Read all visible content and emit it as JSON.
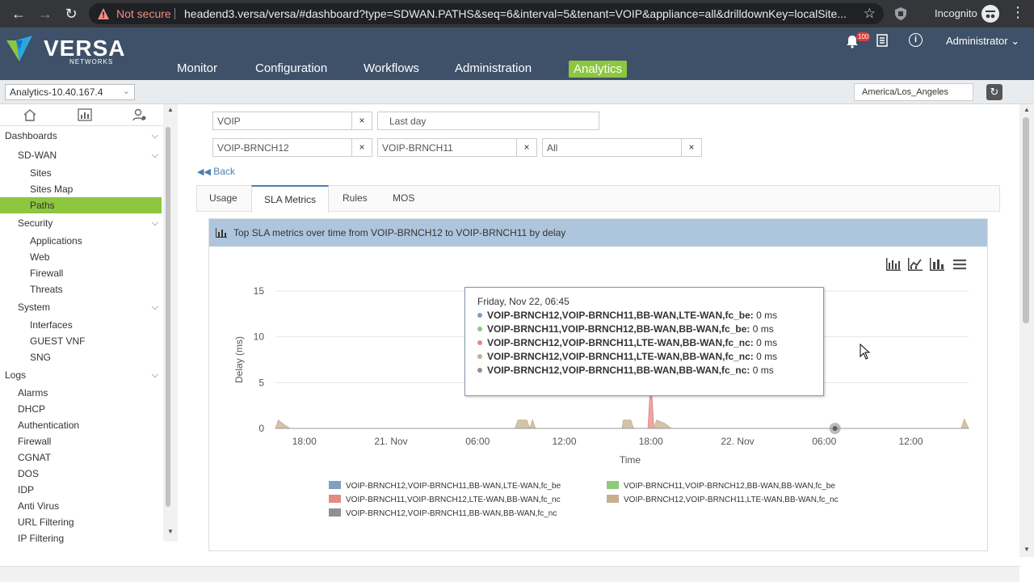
{
  "browser": {
    "not_secure": "Not secure",
    "url": "headend3.versa/versa/#dashboard?type=SDWAN.PATHS&seq=6&interval=5&tenant=VOIP&appliance=all&drilldownKey=localSite...",
    "incognito": "Incognito"
  },
  "brand": {
    "name": "VERSA",
    "sub": "NETWORKS"
  },
  "nav": [
    "Monitor",
    "Configuration",
    "Workflows",
    "Administration",
    "Analytics"
  ],
  "header": {
    "badge": "100",
    "user": "Administrator"
  },
  "subbar": {
    "appliance": "Analytics-10.40.167.4",
    "timezone": "America/Los_Angeles"
  },
  "sidebar": {
    "items": [
      {
        "label": "Dashboards",
        "level": "lvl0",
        "chevron": true
      },
      {
        "label": "SD-WAN",
        "level": "lvl1",
        "chevron": true
      },
      {
        "label": "Sites",
        "level": "lvl2"
      },
      {
        "label": "Sites Map",
        "level": "lvl2"
      },
      {
        "label": "Paths",
        "level": "lvl2",
        "active": true
      },
      {
        "label": "Security",
        "level": "lvl1",
        "chevron": true
      },
      {
        "label": "Applications",
        "level": "lvl2"
      },
      {
        "label": "Web",
        "level": "lvl2"
      },
      {
        "label": "Firewall",
        "level": "lvl2"
      },
      {
        "label": "Threats",
        "level": "lvl2"
      },
      {
        "label": "System",
        "level": "lvl1",
        "chevron": true
      },
      {
        "label": "Interfaces",
        "level": "lvl2"
      },
      {
        "label": "GUEST VNF",
        "level": "lvl2"
      },
      {
        "label": "SNG",
        "level": "lvl2"
      },
      {
        "label": "Logs",
        "level": "lvl0",
        "chevron": true
      },
      {
        "label": "Alarms",
        "level": "lvl1leaf"
      },
      {
        "label": "DHCP",
        "level": "lvl1leaf"
      },
      {
        "label": "Authentication",
        "level": "lvl1leaf"
      },
      {
        "label": "Firewall",
        "level": "lvl1leaf"
      },
      {
        "label": "CGNAT",
        "level": "lvl1leaf"
      },
      {
        "label": "DOS",
        "level": "lvl1leaf"
      },
      {
        "label": "IDP",
        "level": "lvl1leaf"
      },
      {
        "label": "Anti Virus",
        "level": "lvl1leaf"
      },
      {
        "label": "URL Filtering",
        "level": "lvl1leaf"
      },
      {
        "label": "IP Filtering",
        "level": "lvl1leaf"
      }
    ]
  },
  "filters": {
    "tenant": "VOIP",
    "range": "Last day",
    "source": "VOIP-BRNCH12",
    "destination": "VOIP-BRNCH11",
    "path": "All",
    "clear": "×"
  },
  "back": "Back",
  "tabs": [
    "Usage",
    "SLA Metrics",
    "Rules",
    "MOS"
  ],
  "panel": {
    "title": "Top SLA metrics over time from VOIP-BRNCH12 to VOIP-BRNCH11 by delay"
  },
  "tooltip": {
    "date": "Friday, Nov 22, 06:45",
    "rows": [
      {
        "name": "VOIP-BRNCH12,VOIP-BRNCH11,BB-WAN,LTE-WAN,fc_be:",
        "value": "0 ms",
        "color": "#7f9fc3"
      },
      {
        "name": "VOIP-BRNCH11,VOIP-BRNCH12,BB-WAN,BB-WAN,fc_be:",
        "value": "0 ms",
        "color": "#8fca7f"
      },
      {
        "name": "VOIP-BRNCH12,VOIP-BRNCH11,LTE-WAN,BB-WAN,fc_nc:",
        "value": "0 ms",
        "color": "#e38a84"
      },
      {
        "name": "VOIP-BRNCH12,VOIP-BRNCH11,LTE-WAN,BB-WAN,fc_nc:",
        "value": "0 ms",
        "color": "#c6b08f"
      },
      {
        "name": "VOIP-BRNCH12,VOIP-BRNCH11,BB-WAN,BB-WAN,fc_nc:",
        "value": "0 ms",
        "color": "#909090"
      }
    ]
  },
  "chart_data": {
    "type": "area",
    "xlabel": "Time",
    "ylabel": "Delay (ms)",
    "ylim": [
      0,
      15
    ],
    "yticks": [
      "0",
      "5",
      "10",
      "15"
    ],
    "xticks": [
      "18:00",
      "21. Nov",
      "06:00",
      "12:00",
      "18:00",
      "22. Nov",
      "06:00",
      "12:00"
    ],
    "grid": true,
    "legend_position": "bottom",
    "x_unit": "hours since 21 Nov 00:00",
    "xlim": [
      -8,
      40
    ],
    "series": [
      {
        "name": "VOIP-BRNCH12,VOIP-BRNCH11,BB-WAN,LTE-WAN,fc_be",
        "color": "#7f9fc3",
        "x": [
          -8,
          40
        ],
        "values": [
          0,
          0
        ]
      },
      {
        "name": "VOIP-BRNCH11,VOIP-BRNCH12,BB-WAN,BB-WAN,fc_be",
        "color": "#8fca7f",
        "x": [
          -8,
          40
        ],
        "values": [
          0,
          0
        ]
      },
      {
        "name": "VOIP-BRNCH11,VOIP-BRNCH12,LTE-WAN,BB-WAN,fc_nc",
        "color": "#e38a84",
        "x": [
          -8,
          17.8,
          18,
          18.2,
          40
        ],
        "values": [
          0,
          0,
          5.5,
          0,
          0
        ]
      },
      {
        "name": "VOIP-BRNCH12,VOIP-BRNCH11,LTE-WAN,BB-WAN,fc_nc",
        "color": "#c6b08f",
        "x": [
          -8,
          -7.8,
          -7.4,
          -7,
          8.6,
          8.8,
          9.4,
          9.6,
          9.8,
          10,
          16.0,
          16.1,
          16.6,
          16.8,
          18.2,
          18.4,
          19.0,
          19.4,
          39.5,
          39.7,
          40
        ],
        "values": [
          0,
          0.9,
          0.4,
          0,
          0,
          0.9,
          0.9,
          0,
          0.9,
          0,
          0,
          0.9,
          0.9,
          0,
          0,
          0.9,
          0.5,
          0,
          0,
          1.0,
          0
        ]
      },
      {
        "name": "VOIP-BRNCH12,VOIP-BRNCH11,BB-WAN,BB-WAN,fc_nc",
        "color": "#909090",
        "x": [
          -8,
          40
        ],
        "values": [
          0,
          0
        ]
      }
    ],
    "legend": [
      "VOIP-BRNCH12,VOIP-BRNCH11,BB-WAN,LTE-WAN,fc_be",
      "VOIP-BRNCH11,VOIP-BRNCH12,BB-WAN,BB-WAN,fc_be",
      "VOIP-BRNCH11,VOIP-BRNCH12,LTE-WAN,BB-WAN,fc_nc",
      "VOIP-BRNCH12,VOIP-BRNCH11,LTE-WAN,BB-WAN,fc_nc",
      "VOIP-BRNCH12,VOIP-BRNCH11,BB-WAN,BB-WAN,fc_nc"
    ]
  }
}
